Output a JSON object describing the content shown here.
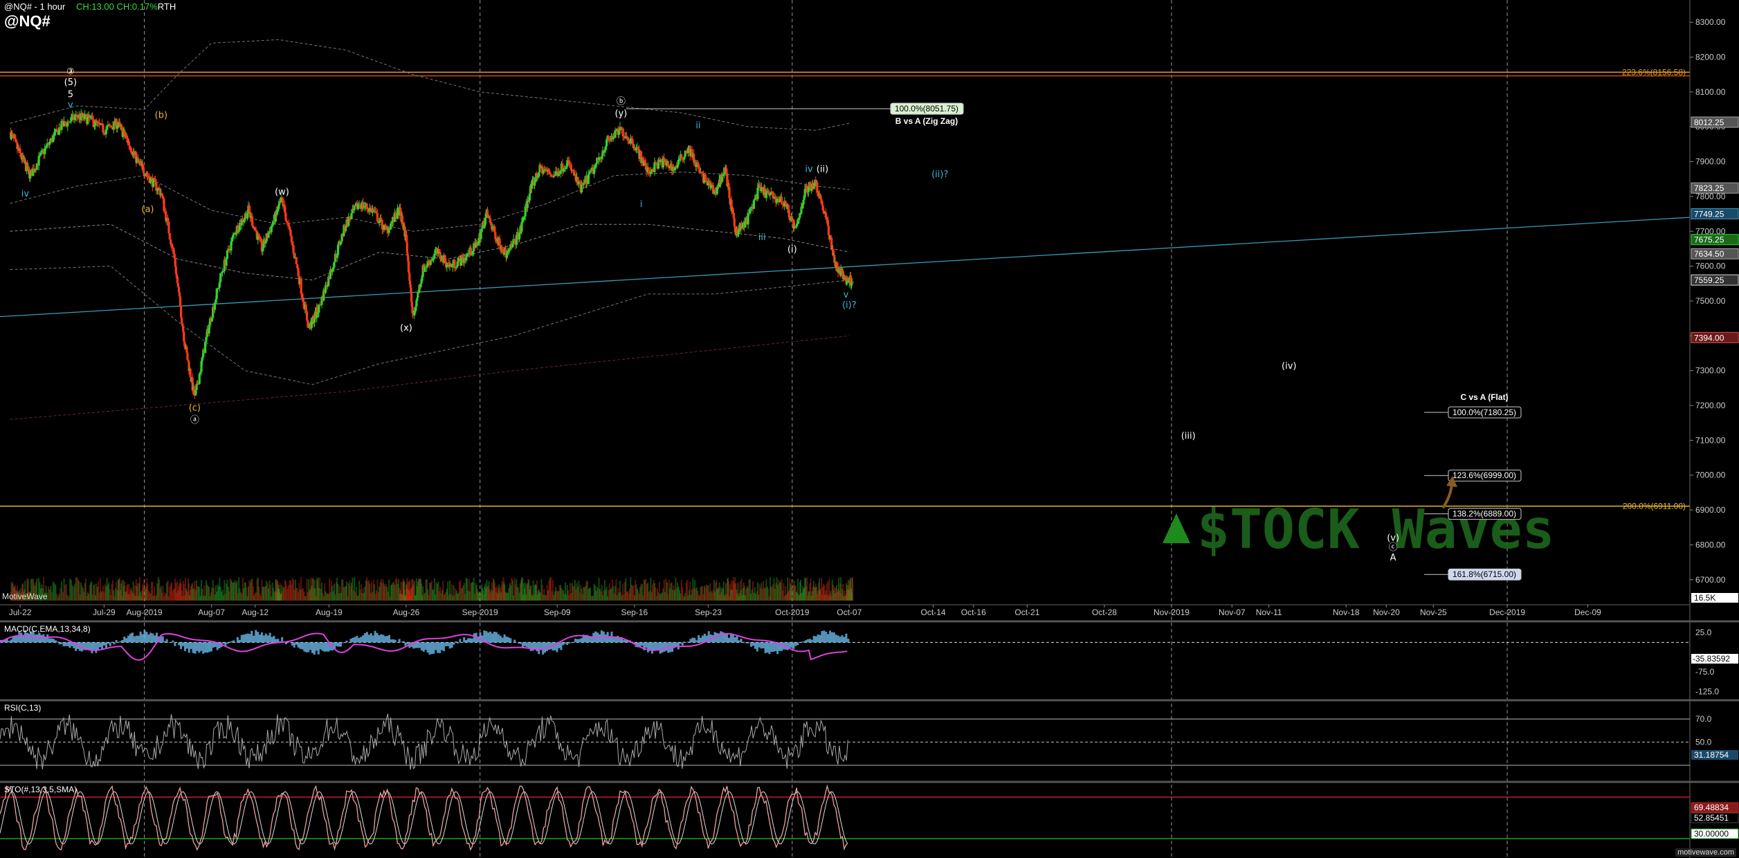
{
  "header": {
    "title": "@NQ# - 1 hour",
    "change": "CH:13.00 CH:0.17%",
    "session": "RTH",
    "symbol": "@NQ#"
  },
  "credit": "MotiveWave",
  "website": "motivewave.com",
  "colors": {
    "up": "#2fd42f",
    "down": "#ff3a1a",
    "wave_yellow": "#e8b830",
    "wave_cyan": "#3ab8d8",
    "trendline": "#3a9ab8",
    "fib_orange": "#e8a020",
    "grid": "#9a9a9a",
    "macd": "#e040e0",
    "macd_hist": "#6ab8e8",
    "stoch": "#f0a0a0"
  },
  "chart_data": [
    {
      "type": "candlestick",
      "panel": "price",
      "yaxis_ticks": [
        8300,
        8200,
        8100,
        8000,
        7900,
        7800,
        7700,
        7600,
        7500,
        7400,
        7300,
        7200,
        7100,
        7000,
        6900,
        6800,
        6700
      ],
      "ylim": [
        6640,
        8340
      ],
      "xaxis_ticks": [
        "Jul-22",
        "Jul-29",
        "Aug-2019",
        "Aug-07",
        "Aug-12",
        "Aug-19",
        "Aug-26",
        "Sep-2019",
        "Sep-09",
        "Sep-16",
        "Sep-23",
        "Oct-2019",
        "Oct-07",
        "Oct-14",
        "Oct-16",
        "Oct-21",
        "Oct-28",
        "Nov-2019",
        "Nov-07",
        "Nov-11",
        "Nov-18",
        "Nov-20",
        "Nov-25",
        "Dec-2019",
        "Dec-09"
      ],
      "price_path": [
        [
          0,
          7985
        ],
        [
          0.3,
          7920
        ],
        [
          0.6,
          7860
        ],
        [
          1.0,
          7930
        ],
        [
          1.5,
          8000
        ],
        [
          2.0,
          8030
        ],
        [
          2.4,
          8020
        ],
        [
          2.8,
          7990
        ],
        [
          3.2,
          8010
        ],
        [
          3.5,
          7960
        ],
        [
          3.8,
          7900
        ],
        [
          4.1,
          7860
        ],
        [
          4.5,
          7810
        ],
        [
          4.9,
          7620
        ],
        [
          5.2,
          7380
        ],
        [
          5.5,
          7220
        ],
        [
          5.9,
          7420
        ],
        [
          6.3,
          7580
        ],
        [
          6.7,
          7700
        ],
        [
          7.1,
          7760
        ],
        [
          7.5,
          7650
        ],
        [
          7.9,
          7740
        ],
        [
          8.1,
          7790
        ],
        [
          8.5,
          7620
        ],
        [
          8.9,
          7420
        ],
        [
          9.2,
          7480
        ],
        [
          9.6,
          7600
        ],
        [
          10.0,
          7720
        ],
        [
          10.4,
          7780
        ],
        [
          10.8,
          7760
        ],
        [
          11.2,
          7700
        ],
        [
          11.6,
          7760
        ],
        [
          11.8,
          7680
        ],
        [
          12.0,
          7450
        ],
        [
          12.3,
          7590
        ],
        [
          12.7,
          7640
        ],
        [
          13.1,
          7600
        ],
        [
          13.5,
          7620
        ],
        [
          13.9,
          7660
        ],
        [
          14.2,
          7750
        ],
        [
          14.5,
          7680
        ],
        [
          14.8,
          7630
        ],
        [
          15.2,
          7700
        ],
        [
          15.5,
          7820
        ],
        [
          15.8,
          7880
        ],
        [
          16.2,
          7860
        ],
        [
          16.6,
          7900
        ],
        [
          17.0,
          7820
        ],
        [
          17.4,
          7880
        ],
        [
          17.8,
          7960
        ],
        [
          18.2,
          7990
        ],
        [
          18.6,
          7950
        ],
        [
          19.0,
          7870
        ],
        [
          19.4,
          7900
        ],
        [
          19.8,
          7880
        ],
        [
          20.2,
          7940
        ],
        [
          20.6,
          7860
        ],
        [
          21.0,
          7810
        ],
        [
          21.3,
          7880
        ],
        [
          21.6,
          7700
        ],
        [
          21.9,
          7720
        ],
        [
          22.3,
          7820
        ],
        [
          22.7,
          7800
        ],
        [
          23.1,
          7780
        ],
        [
          23.4,
          7700
        ],
        [
          23.7,
          7820
        ],
        [
          24.0,
          7840
        ],
        [
          24.3,
          7740
        ],
        [
          24.6,
          7600
        ],
        [
          24.9,
          7560
        ],
        [
          25.1,
          7560
        ]
      ],
      "x_range": [
        -0.3,
        50
      ],
      "x_tick_positions": [
        0.3,
        2.8,
        4.0,
        6.0,
        7.3,
        9.5,
        11.8,
        14.0,
        16.3,
        18.6,
        20.8,
        23.3,
        25.0,
        27.5,
        28.7,
        30.3,
        32.6,
        34.6,
        36.4,
        37.5,
        39.8,
        41.0,
        42.4,
        44.6,
        47.0
      ],
      "price_labels": [
        {
          "value": "8051.75"
        },
        {
          "value": "8012.25"
        },
        {
          "value": "7823.25"
        },
        {
          "value": "7749.25"
        },
        {
          "value": "7675.25"
        },
        {
          "value": "7634.50"
        },
        {
          "value": "7559.25"
        },
        {
          "value": "7394.00"
        }
      ],
      "volume_label": "16.5K",
      "fib_levels": [
        {
          "label": "223.6%(8156.58)",
          "value": 8156.58,
          "color": "#e8a020"
        },
        {
          "label": "200.0%(6911.00)",
          "value": 6911.0,
          "color": "#e8b830"
        }
      ],
      "fib_boxes": [
        {
          "label": "100.0%(8051.75)",
          "value": 8051.75,
          "sub": "B vs A (Zig Zag)"
        },
        {
          "label": "100.0%(7180.25)",
          "value": 7180.25,
          "sub": "C vs A (Flat)"
        },
        {
          "label": "123.6%(6999.00)",
          "value": 6999.0
        },
        {
          "label": "138.2%(6889.00)",
          "value": 6889.0
        },
        {
          "label": "161.8%(6715.00)",
          "value": 6715.0
        }
      ],
      "wave_labels": [
        {
          "text": "③",
          "x": 1.8,
          "y": 8150,
          "color": "#ffffff"
        },
        {
          "text": "(5)",
          "x": 1.8,
          "y": 8120,
          "color": "#ffffff"
        },
        {
          "text": "5",
          "x": 1.8,
          "y": 8085,
          "color": "#ffffff"
        },
        {
          "text": "v",
          "x": 1.8,
          "y": 8055,
          "color": "#3ab8d8"
        },
        {
          "text": "iv",
          "x": 0.45,
          "y": 7800,
          "color": "#3ab8d8"
        },
        {
          "text": "(b)",
          "x": 4.5,
          "y": 8025,
          "color": "#e8b830"
        },
        {
          "text": "(a)",
          "x": 4.1,
          "y": 7755,
          "color": "#e8b830"
        },
        {
          "text": "(c)",
          "x": 5.5,
          "y": 7185,
          "color": "#e8b830"
        },
        {
          "text": "ⓐ",
          "x": 5.5,
          "y": 7150,
          "color": "#ffffff"
        },
        {
          "text": "(w)",
          "x": 8.1,
          "y": 7805,
          "color": "#ffffff"
        },
        {
          "text": "(x)",
          "x": 11.8,
          "y": 7415,
          "color": "#ffffff"
        },
        {
          "text": "ⓑ",
          "x": 18.2,
          "y": 8065,
          "color": "#ffffff"
        },
        {
          "text": "(y)",
          "x": 18.2,
          "y": 8030,
          "color": "#ffffff"
        },
        {
          "text": "i",
          "x": 18.8,
          "y": 7770,
          "color": "#3ab8d8"
        },
        {
          "text": "ii",
          "x": 20.5,
          "y": 7995,
          "color": "#3ab8d8"
        },
        {
          "text": "iii",
          "x": 22.4,
          "y": 7675,
          "color": "#3ab8d8"
        },
        {
          "text": "(i)",
          "x": 23.3,
          "y": 7640,
          "color": "#ffffff"
        },
        {
          "text": "iv",
          "x": 23.8,
          "y": 7870,
          "color": "#3ab8d8"
        },
        {
          "text": "(ii)",
          "x": 24.2,
          "y": 7870,
          "color": "#ffffff"
        },
        {
          "text": "v",
          "x": 24.9,
          "y": 7510,
          "color": "#3ab8d8"
        },
        {
          "text": "(i)?",
          "x": 25.0,
          "y": 7480,
          "color": "#3ab8d8"
        },
        {
          "text": "(ii)?",
          "x": 27.7,
          "y": 7855,
          "color": "#3ab8d8"
        },
        {
          "text": "(iii)",
          "x": 35.1,
          "y": 7105,
          "color": "#ffffff"
        },
        {
          "text": "(iv)",
          "x": 38.1,
          "y": 7305,
          "color": "#ffffff"
        },
        {
          "text": "(v)",
          "x": 41.2,
          "y": 6812,
          "color": "#ffffff"
        },
        {
          "text": "ⓒ",
          "x": 41.2,
          "y": 6785,
          "color": "#ffffff"
        },
        {
          "text": "A",
          "x": 41.2,
          "y": 6755,
          "color": "#ffffff"
        }
      ],
      "watermark": "$TOCK Waves"
    },
    {
      "type": "line",
      "panel": "macd",
      "title": "MACD(C,EMA,13,34,8)",
      "yaxis_ticks": [
        25.0,
        -75.0,
        -125.0
      ],
      "ylim": [
        -140,
        50
      ],
      "current_label": "-35.83592"
    },
    {
      "type": "line",
      "panel": "rsi",
      "title": "RSI(C,13)",
      "yaxis_ticks": [
        70.0,
        50.0
      ],
      "ylim": [
        18,
        85
      ],
      "current_label": "31.18754",
      "levels": [
        70,
        50,
        30
      ]
    },
    {
      "type": "line",
      "panel": "stoch",
      "title": "STO(#,13,3,5,SMA)",
      "ylim": [
        0,
        100
      ],
      "current_labels": [
        "69.48834",
        "52.85451",
        "30.00000"
      ],
      "levels": [
        80,
        20
      ]
    }
  ]
}
